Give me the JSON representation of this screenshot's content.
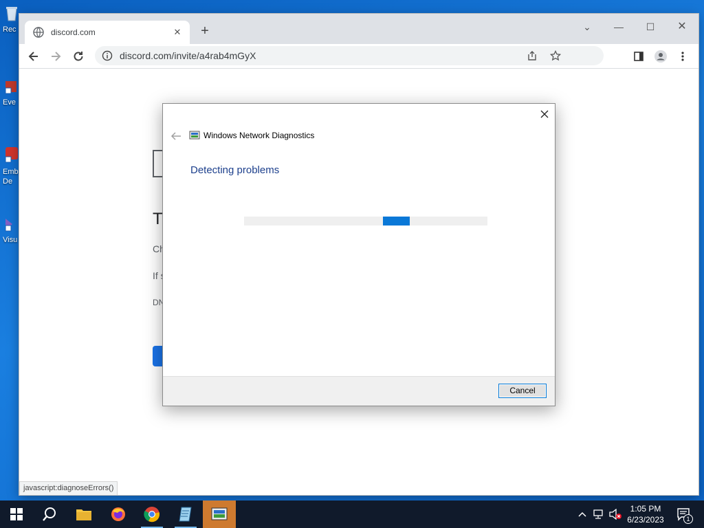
{
  "desktop": {
    "icons": [
      {
        "label": "Rec",
        "icon": "recycle-bin-icon"
      },
      {
        "label": "Eve",
        "icon": "shortcut-icon"
      },
      {
        "label": "Emb\nDe",
        "icon": "shortcut-icon"
      },
      {
        "label": "Visu",
        "icon": "visual-studio-icon"
      }
    ]
  },
  "browser": {
    "tab": {
      "title": "discord.com",
      "favicon": "globe-icon"
    },
    "address_url": "discord.com/invite/a4rab4mGyX",
    "status_text": "javascript:diagnoseErrors()",
    "page_fragments": {
      "heading_start": "T",
      "line1_start": "Ch",
      "line2_start": "If s",
      "code_start": "DN"
    }
  },
  "dialog": {
    "title": "Windows Network Diagnostics",
    "heading": "Detecting problems",
    "progress_label": "indeterminate",
    "cancel_label": "Cancel"
  },
  "taskbar": {
    "apps": [
      "windows-start-icon",
      "search-icon",
      "file-explorer-icon",
      "firefox-icon",
      "chrome-icon",
      "notepad-icon",
      "network-diagnostics-icon"
    ],
    "clock_time": "1:05 PM",
    "clock_date": "6/23/2023",
    "notification_count": "1"
  },
  "colors": {
    "accent": "#0078d7",
    "dialog_heading": "#1c3f8c",
    "taskbar_active": "#ce7a2f"
  }
}
